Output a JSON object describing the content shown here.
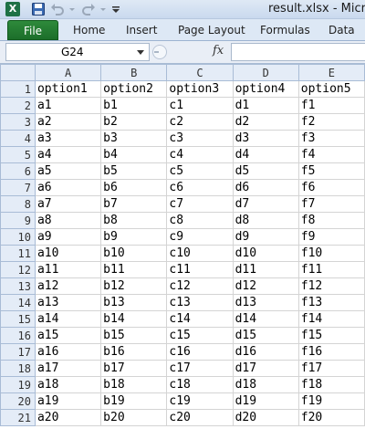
{
  "titlebar": {
    "app_icon": "excel-icon",
    "app_icon_letter": "X",
    "title": "result.xlsx  -  Micro"
  },
  "ribbon": {
    "file_label": "File",
    "tabs": [
      "Home",
      "Insert",
      "Page Layout",
      "Formulas",
      "Data"
    ]
  },
  "formula_bar": {
    "name_box": "G24",
    "fx_label": "fx",
    "formula": ""
  },
  "sheet": {
    "columns": [
      "A",
      "B",
      "C",
      "D",
      "E"
    ],
    "rows": [
      [
        "option1",
        "option2",
        "option3",
        "option4",
        "option5"
      ],
      [
        "a1",
        "b1",
        "c1",
        "d1",
        "f1"
      ],
      [
        "a2",
        "b2",
        "c2",
        "d2",
        "f2"
      ],
      [
        "a3",
        "b3",
        "c3",
        "d3",
        "f3"
      ],
      [
        "a4",
        "b4",
        "c4",
        "d4",
        "f4"
      ],
      [
        "a5",
        "b5",
        "c5",
        "d5",
        "f5"
      ],
      [
        "a6",
        "b6",
        "c6",
        "d6",
        "f6"
      ],
      [
        "a7",
        "b7",
        "c7",
        "d7",
        "f7"
      ],
      [
        "a8",
        "b8",
        "c8",
        "d8",
        "f8"
      ],
      [
        "a9",
        "b9",
        "c9",
        "d9",
        "f9"
      ],
      [
        "a10",
        "b10",
        "c10",
        "d10",
        "f10"
      ],
      [
        "a11",
        "b11",
        "c11",
        "d11",
        "f11"
      ],
      [
        "a12",
        "b12",
        "c12",
        "d12",
        "f12"
      ],
      [
        "a13",
        "b13",
        "c13",
        "d13",
        "f13"
      ],
      [
        "a14",
        "b14",
        "c14",
        "d14",
        "f14"
      ],
      [
        "a15",
        "b15",
        "c15",
        "d15",
        "f15"
      ],
      [
        "a16",
        "b16",
        "c16",
        "d16",
        "f16"
      ],
      [
        "a17",
        "b17",
        "c17",
        "d17",
        "f17"
      ],
      [
        "a18",
        "b18",
        "c18",
        "d18",
        "f18"
      ],
      [
        "a19",
        "b19",
        "c19",
        "d19",
        "f19"
      ],
      [
        "a20",
        "b20",
        "c20",
        "d20",
        "f20"
      ]
    ]
  },
  "colors": {
    "file_tab": "#1c6e2a",
    "header_bg": "#e4ecf7",
    "gridline": "#d4d4d4"
  }
}
